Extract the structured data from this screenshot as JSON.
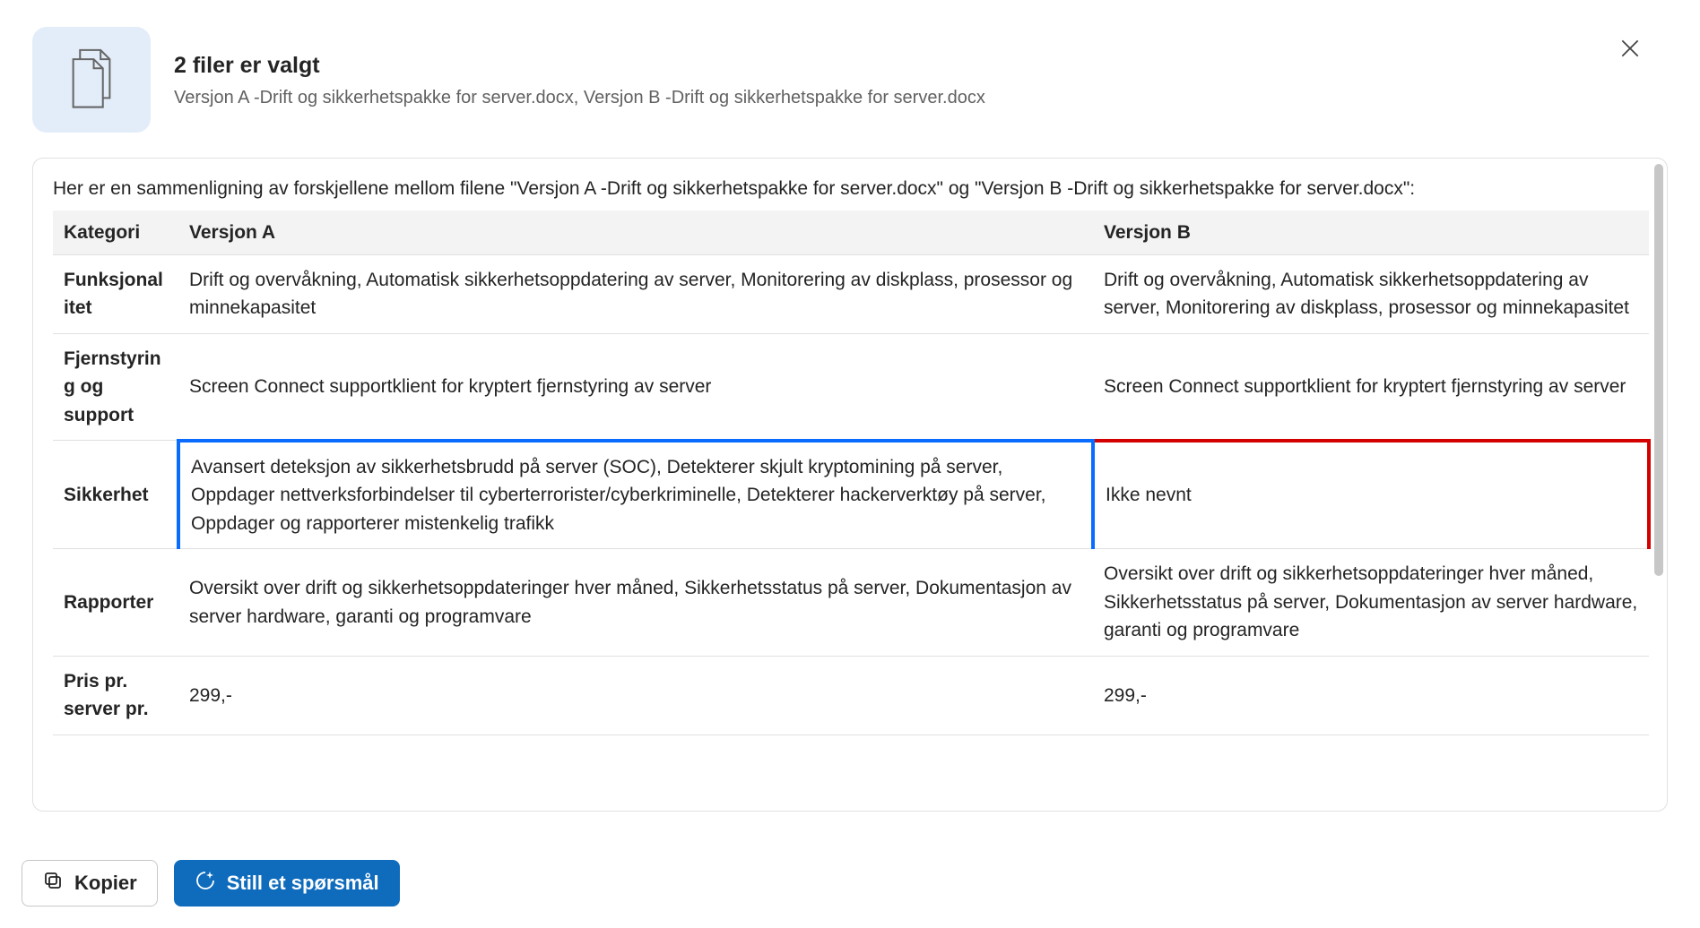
{
  "header": {
    "title": "2 filer er valgt",
    "subtitle": "Versjon A -Drift og sikkerhetspakke for server.docx, Versjon B -Drift og sikkerhetspakke for server.docx"
  },
  "intro": "Her er en sammenligning av forskjellene mellom filene \"Versjon A -Drift og sikkerhetspakke for server.docx\" og \"Versjon B -Drift og sikkerhetspakke for server.docx\":",
  "table": {
    "columns": {
      "cat": "Kategori",
      "a": "Versjon A",
      "b": "Versjon B"
    },
    "rows": [
      {
        "cat": "Funksjonalitet",
        "a": "Drift og overvåkning, Automatisk sikkerhetsoppdatering av server, Monitorering av diskplass, prosessor og minnekapasitet",
        "b": "Drift og overvåkning, Automatisk sikkerhetsoppdatering av server, Monitorering av diskplass, prosessor og minnekapasitet"
      },
      {
        "cat": "Fjernstyring og support",
        "a": "Screen Connect supportklient for kryptert fjernstyring av server",
        "b": "Screen Connect supportklient for kryptert fjernstyring av server"
      },
      {
        "cat": "Sikkerhet",
        "a": "Avansert deteksjon av sikkerhetsbrudd på server (SOC), Detekterer skjult kryptomining på server, Oppdager nettverksforbindelser til cyberterrorister/cyberkriminelle, Detekterer hackerverktøy på server, Oppdager og rapporterer mistenkelig trafikk",
        "b": "Ikke nevnt",
        "highlight": true
      },
      {
        "cat": "Rapporter",
        "a": "Oversikt over drift og sikkerhetsoppdateringer hver måned, Sikkerhetsstatus på server, Dokumentasjon av server hardware, garanti og programvare",
        "b": "Oversikt over drift og sikkerhetsoppdateringer hver måned, Sikkerhetsstatus på server, Dokumentasjon av server hardware, garanti og programvare"
      },
      {
        "cat": "Pris pr. server pr.",
        "a": "299,-",
        "b": "299,-"
      }
    ]
  },
  "actions": {
    "copy": "Kopier",
    "ask": "Still et spørsmål"
  }
}
